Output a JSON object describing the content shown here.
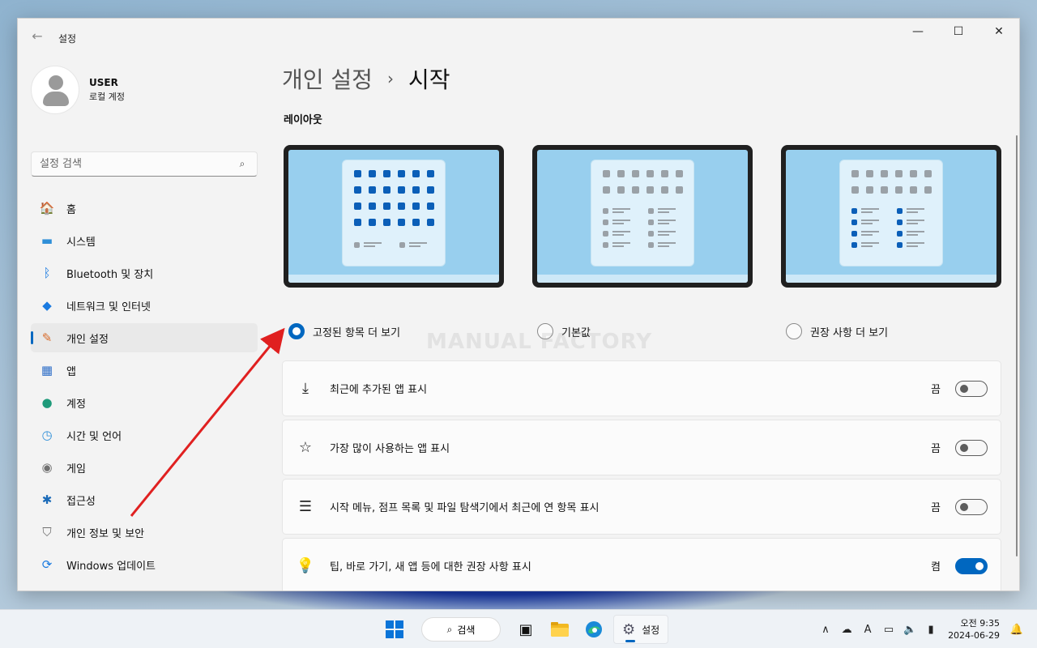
{
  "window": {
    "app_title": "설정",
    "back_icon": "←",
    "minimize_icon": "—",
    "maximize_icon": "☐",
    "close_icon": "✕"
  },
  "profile": {
    "name": "USER",
    "account_type": "로컬 계정"
  },
  "search": {
    "placeholder": "설정 검색",
    "icon": "⌕"
  },
  "sidebar": {
    "items": [
      {
        "label": "홈",
        "icon": "home-icon",
        "glyph": "🏠",
        "active": false
      },
      {
        "label": "시스템",
        "icon": "system-icon",
        "glyph": "▬",
        "active": false
      },
      {
        "label": "Bluetooth 및 장치",
        "icon": "bluetooth-icon",
        "glyph": "ᛒ",
        "active": false
      },
      {
        "label": "네트워크 및 인터넷",
        "icon": "wifi-icon",
        "glyph": "◆",
        "active": false
      },
      {
        "label": "개인 설정",
        "icon": "brush-icon",
        "glyph": "✎",
        "active": true
      },
      {
        "label": "앱",
        "icon": "apps-icon",
        "glyph": "▦",
        "active": false
      },
      {
        "label": "계정",
        "icon": "account-icon",
        "glyph": "●",
        "active": false
      },
      {
        "label": "시간 및 언어",
        "icon": "time-language-icon",
        "glyph": "◷",
        "active": false
      },
      {
        "label": "게임",
        "icon": "gamepad-icon",
        "glyph": "◉",
        "active": false
      },
      {
        "label": "접근성",
        "icon": "accessibility-icon",
        "glyph": "✱",
        "active": false
      },
      {
        "label": "개인 정보 및 보안",
        "icon": "shield-icon",
        "glyph": "⛉",
        "active": false
      },
      {
        "label": "Windows 업데이트",
        "icon": "update-icon",
        "glyph": "⟳",
        "active": false
      }
    ]
  },
  "breadcrumb": {
    "parent": "개인 설정",
    "separator": "›",
    "current": "시작"
  },
  "layout_section": {
    "label": "레이아웃",
    "options": [
      {
        "label": "고정된 항목 더 보기",
        "checked": true
      },
      {
        "label": "기본값",
        "checked": false
      },
      {
        "label": "권장 사항 더 보기",
        "checked": false
      }
    ]
  },
  "watermark": "MANUAL FACTORY",
  "settings": [
    {
      "label": "최근에 추가된 앱 표시",
      "icon": "download-icon",
      "glyph": "⤓",
      "state": "끔",
      "on": false
    },
    {
      "label": "가장 많이 사용하는 앱 표시",
      "icon": "star-icon",
      "glyph": "☆",
      "state": "끔",
      "on": false
    },
    {
      "label": "시작 메뉴, 점프 목록 및 파일 탐색기에서 최근에 연 항목 표시",
      "icon": "list-icon",
      "glyph": "☰",
      "state": "끔",
      "on": false
    },
    {
      "label": "팁, 바로 가기, 새 앱 등에 대한 권장 사항 표시",
      "icon": "lightbulb-icon",
      "glyph": "💡",
      "state": "켬",
      "on": true
    }
  ],
  "taskbar": {
    "search_label": "검색",
    "settings_label": "설정",
    "clock_time": "오전 9:35",
    "clock_date": "2024-06-29",
    "tray_chevron": "∧",
    "ime": "A"
  },
  "colors": {
    "accent": "#0067c0",
    "annotation_arrow": "#e02020"
  }
}
